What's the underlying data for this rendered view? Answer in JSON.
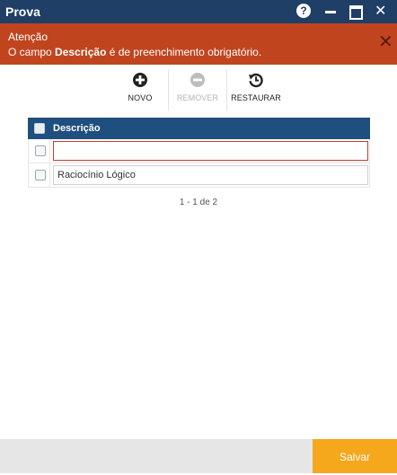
{
  "window": {
    "title": "Prova",
    "help_glyph": "?",
    "close_glyph": "✕"
  },
  "alert": {
    "title": "Atenção",
    "message_prefix": "O campo ",
    "message_field": "Descrição",
    "message_suffix": " é de preenchimento obrigatório.",
    "close_glyph": "✕",
    "color": "#c0451f"
  },
  "toolbar": {
    "new_label": "NOVO",
    "remove_label": "REMOVER",
    "restore_label": "RESTAURAR"
  },
  "grid": {
    "header": "Descrição",
    "rows": [
      {
        "value": ""
      },
      {
        "value": "Raciocínio Lógico"
      }
    ]
  },
  "pager": {
    "text": "1 - 1 de 2"
  },
  "footer": {
    "save_label": "Salvar",
    "accent": "#f5a81c"
  },
  "colors": {
    "titlebar": "#1f3f66",
    "grid_header": "#1f4f7e"
  }
}
